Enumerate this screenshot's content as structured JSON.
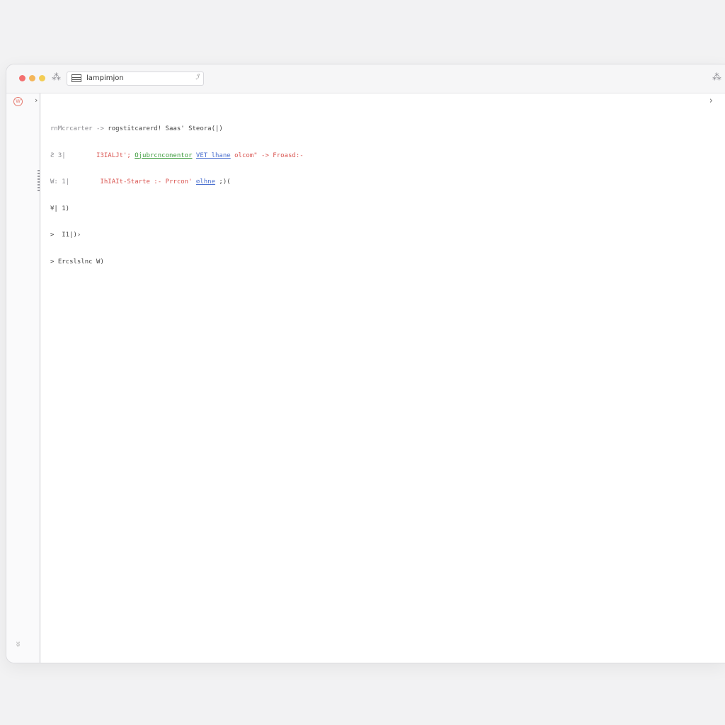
{
  "window": {
    "address_text": "lampimjon",
    "address_end": "ℐ",
    "toolbar_left_icon": "⁂",
    "toolbar_right_icon": "⁂",
    "gutter_badge": "W",
    "gutter_chevron": "›",
    "right_chevron": "›",
    "gutter_bottom": "ʬ"
  },
  "code": {
    "line1": {
      "a": "rnMcrcarter -> ",
      "b": "rogstitcarerd! Saas' Steora(|)"
    },
    "line2": {
      "a": "Ƨ 3|        ",
      "b": "I3IALJt'; ",
      "c": "Ojubrcnconentor",
      "d": " ",
      "e": "VET lhane",
      "f": " olcom\" -> Froasd:-"
    },
    "line3": {
      "a": "W: 1|        ",
      "b": "IhIAIt-Starte :- Prrcon' ",
      "c": "⊘lhne",
      "d": " ;)("
    },
    "line4": {
      "a": "¥| 1)"
    },
    "line5": {
      "a": ">  I1|)›"
    },
    "line6": {
      "a": "> Ercslslnc W)"
    }
  },
  "colors": {
    "red": "#d9534f",
    "green": "#3a9a3a",
    "blue": "#4a6fcf",
    "traffic_red": "#f36f6f",
    "traffic_orange": "#f4b65a",
    "traffic_yellow": "#f3cd55"
  }
}
